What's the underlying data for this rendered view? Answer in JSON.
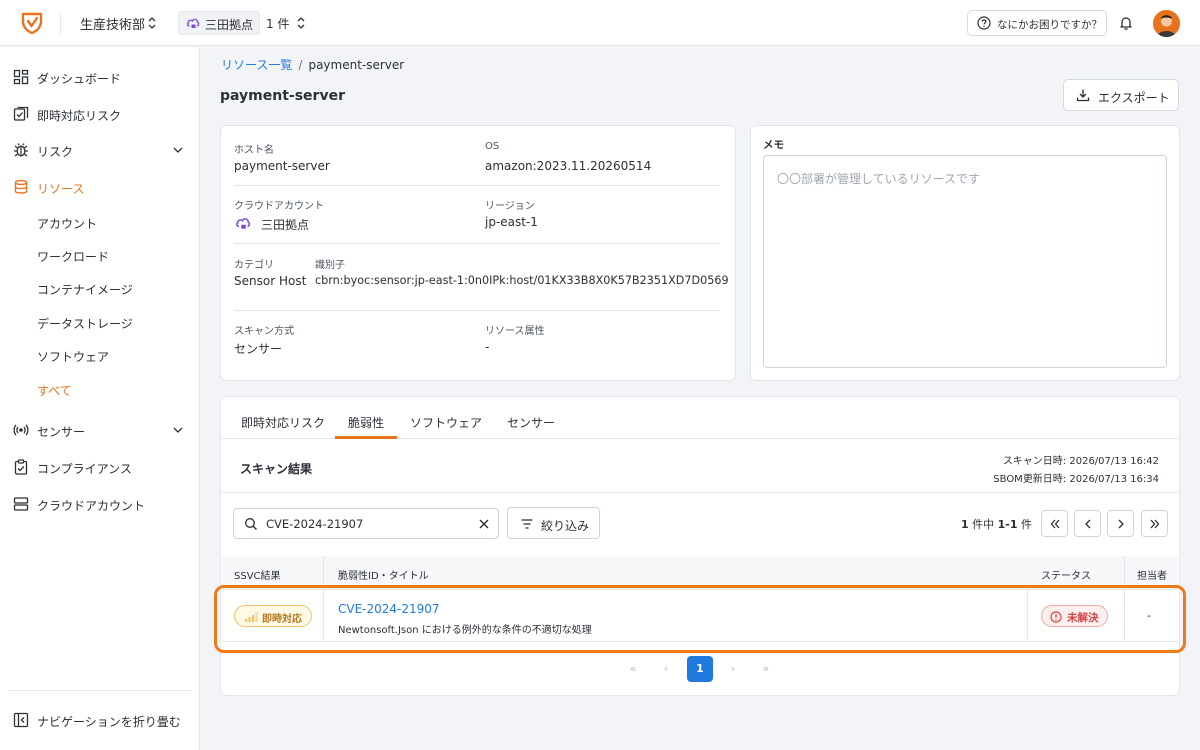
{
  "header": {
    "department": "生産技術部",
    "location": "三田拠点",
    "count": "1 件",
    "help": "なにかお困りですか？"
  },
  "sidebar": {
    "items": [
      {
        "label": "ダッシュボード"
      },
      {
        "label": "即時対応リスク"
      },
      {
        "label": "リスク"
      },
      {
        "label": "リソース"
      },
      {
        "label": "センサー"
      },
      {
        "label": "コンプライアンス"
      },
      {
        "label": "クラウドアカウント"
      }
    ],
    "resource_sub": [
      "アカウント",
      "ワークロード",
      "コンテナイメージ",
      "データストレージ",
      "ソフトウェア",
      "すべて"
    ],
    "collapse": "ナビゲーションを折り畳む"
  },
  "breadcrumb": {
    "parent": "リソース一覧",
    "current": "payment-server"
  },
  "page_title": "payment-server",
  "export_label": "エクスポート",
  "info": {
    "host_label": "ホスト名",
    "host": "payment-server",
    "os_label": "OS",
    "os": "amazon:2023.11.20260514",
    "account_label": "クラウドアカウント",
    "account": "三田拠点",
    "region_label": "リージョン",
    "region": "jp-east-1",
    "category_label": "カテゴリ",
    "category": "Sensor Host",
    "identifier_label": "識別子",
    "identifier": "cbrn:byoc:sensor:jp-east-1:0n0IPk:host/01KX33B8X0K57B2351XD7D0569",
    "scan_label": "スキャン方式",
    "scan": "センサー",
    "attr_label": "リソース属性",
    "attr": "-"
  },
  "memo": {
    "label": "メモ",
    "placeholder": "〇〇部署が管理しているリソースです"
  },
  "tabs": [
    "即時対応リスク",
    "脆弱性",
    "ソフトウェア",
    "センサー"
  ],
  "scan": {
    "title": "スキャン結果",
    "scan_date": "スキャン日時: 2026/07/13 16:42",
    "sbom_date": "SBOM更新日時: 2026/07/13 16:34"
  },
  "search": {
    "value": "CVE-2024-21907"
  },
  "filter_label": "絞り込み",
  "results": {
    "total": "1",
    "total_suffix": " 件中 ",
    "range": "1-1",
    "range_suffix": " 件"
  },
  "table": {
    "headers": [
      "SSVC結果",
      "脆弱性ID・タイトル",
      "ステータス",
      "担当者"
    ],
    "rows": [
      {
        "ssvc": "即時対応",
        "id": "CVE-2024-21907",
        "title": "Newtonsoft.Json における例外的な条件の不適切な処理",
        "status": "未解決",
        "assignee": "-"
      }
    ]
  },
  "pagination": {
    "first": "«",
    "prev": "‹",
    "page": "1",
    "next": "›",
    "last": "»"
  },
  "colors": {
    "accent": "#e8731f",
    "link": "#1f7ae0",
    "danger": "#d64545",
    "warning": "#b7791f"
  }
}
